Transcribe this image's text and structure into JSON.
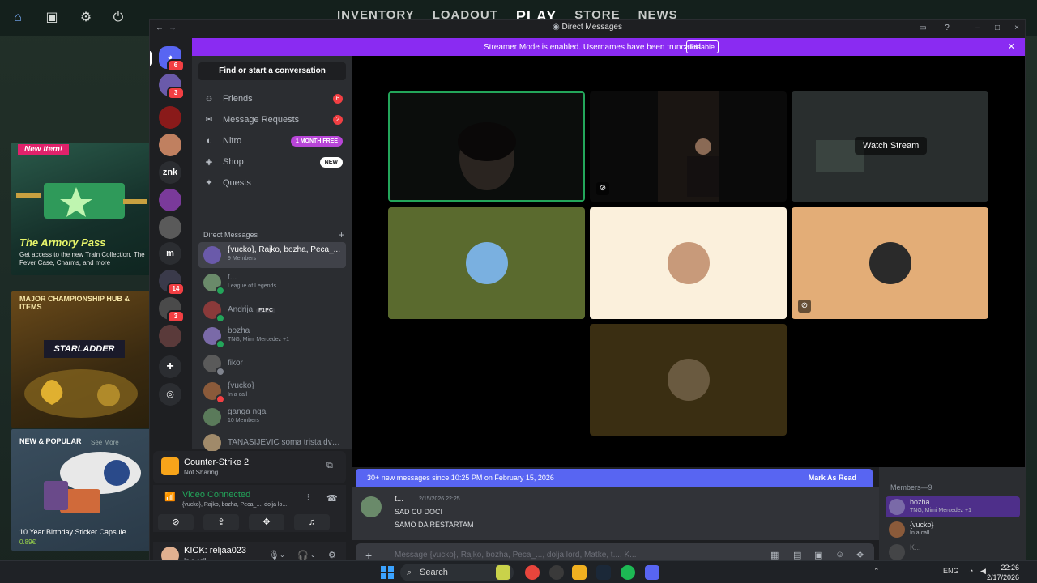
{
  "game": {
    "nav": [
      "INVENTORY",
      "LOADOUT",
      "PLAY",
      "STORE",
      "NEWS"
    ],
    "cards": {
      "armory_badge": "New Item!",
      "armory_title": "The Armory Pass",
      "armory_sub": "Get access to the new Train Collection, The Fever Case, Charms, and more",
      "major_title": "MAJOR CHAMPIONSHIP HUB & ITEMS",
      "major_logo": "STARLADDER",
      "new_title": "NEW & POPULAR",
      "new_see": "See More",
      "new_item": "10 Year Birthday Sticker Capsule",
      "new_price": "0.89€"
    }
  },
  "window": {
    "title": "Direct Messages"
  },
  "banner": {
    "message": "Streamer Mode is enabled. Usernames have been truncated.",
    "disable": "Disable"
  },
  "rail": {
    "znk": "znk",
    "m": "m",
    "badge_home": "6",
    "badge_2": "3",
    "badge_14": "14",
    "badge_3": "3"
  },
  "sidebar": {
    "find": "Find or start a conversation",
    "friends": "Friends",
    "friends_count": "6",
    "requests": "Message Requests",
    "requests_count": "2",
    "nitro": "Nitro",
    "nitro_tag": "1 MONTH FREE",
    "shop": "Shop",
    "shop_tag": "NEW",
    "quests": "Quests",
    "dm_header": "Direct Messages",
    "dms": [
      {
        "name": "{vucko}, Rajko, bozha, Peca_...",
        "sub": "9 Members"
      },
      {
        "name": "t...",
        "sub": "League of Legends"
      },
      {
        "name": "Andrija",
        "tag": "F1PC"
      },
      {
        "name": "bozha",
        "sub": "TNG, Mimi Mercedez +1"
      },
      {
        "name": "fikor"
      },
      {
        "name": "{vucko}",
        "sub": "In a call"
      },
      {
        "name": "ganga nga",
        "sub": "10 Members"
      },
      {
        "name": "TANASIJEVIC soma trista dva..."
      }
    ]
  },
  "voice": {
    "game": "Counter-Strike 2",
    "game_sub": "Not Sharing",
    "status": "Video Connected",
    "channel": "{vucko}, Rajko, bozha, Peca_..., dolja lo..."
  },
  "user": {
    "name": "KICK: reljaa023",
    "status": "In a call"
  },
  "call": {
    "watch_stream": "Watch Stream"
  },
  "chat": {
    "new_messages": "30+ new messages since 10:25 PM on February 15, 2026",
    "mark_read": "Mark As Read",
    "author": "t...",
    "time": "2/15/2026 22:25",
    "lines": [
      "SAD CU DOCI",
      "SAMO DA RESTARTAM"
    ],
    "placeholder": "Message {vucko}, Rajko, bozha, Peca_..., dolja lord, Matke, t..., K..."
  },
  "members": {
    "header": "Members—9",
    "list": [
      {
        "name": "bozha",
        "sub": "TNG, Mimi Mercedez +1"
      },
      {
        "name": "{vucko}",
        "sub": "In a call"
      },
      {
        "name": "K..."
      }
    ]
  },
  "taskbar": {
    "search": "Search",
    "lang": "ENG",
    "time": "22:26",
    "date": "2/17/2026"
  },
  "colors": {
    "accent": "#5865f2",
    "banner": "#8a2bf2",
    "online": "#23a55a",
    "danger": "#f23f43"
  }
}
